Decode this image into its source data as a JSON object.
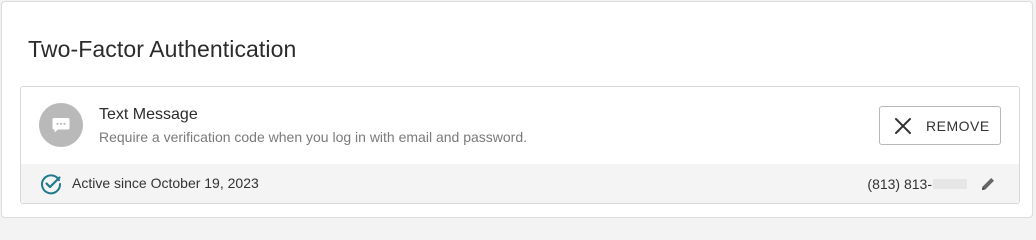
{
  "section": {
    "title": "Two-Factor Authentication"
  },
  "method": {
    "icon": "chat-bubble-icon",
    "title": "Text Message",
    "description": "Require a verification code when you log in with email and password.",
    "remove_label": "REMOVE",
    "remove_icon": "close-icon",
    "status": {
      "icon": "check-circle-icon",
      "text": "Active since October 19, 2023"
    },
    "phone": {
      "text": "(813) 813-"
    },
    "edit_icon": "pencil-icon"
  },
  "colors": {
    "accent": "#1f7a8c",
    "avatar_bg": "#b9b9b9",
    "footer_bg": "#f4f4f4"
  }
}
